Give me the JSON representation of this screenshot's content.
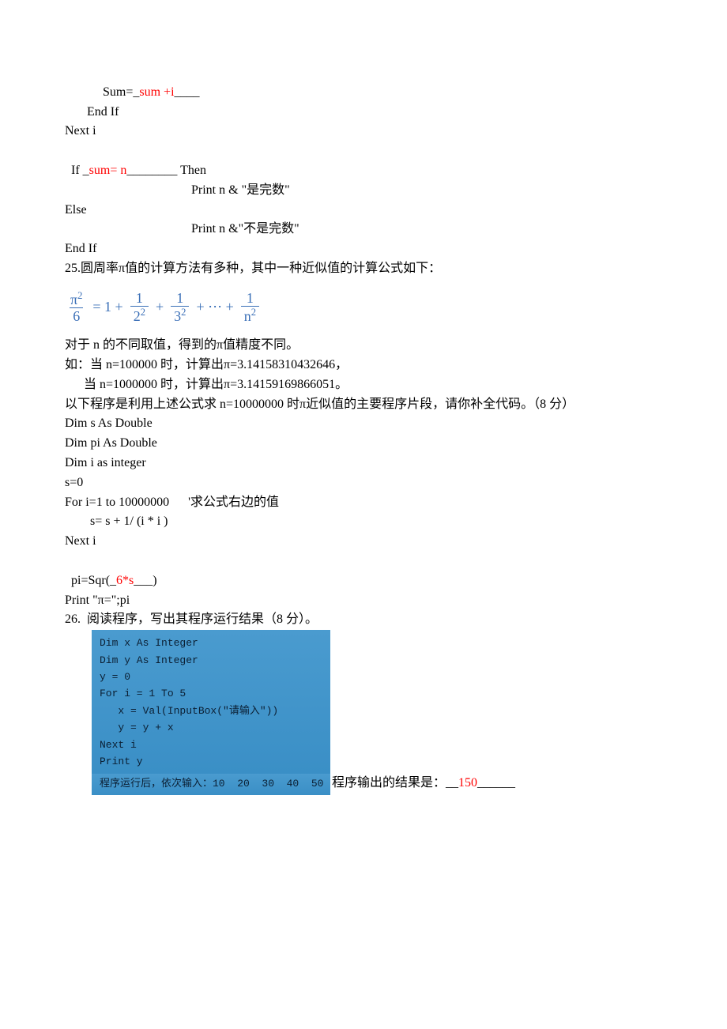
{
  "block24": {
    "l1a": "          Sum=_",
    "l1_ans": "sum +i",
    "l1b": "____",
    "l2": "       End If",
    "l3": "Next i",
    "l4a": "If _",
    "l4_ans": "sum= n",
    "l4b": "________ Then",
    "l5": "Print n & \"是完数\"",
    "l6": "Else",
    "l7": "Print n &\"不是完数\"",
    "l8": "End If"
  },
  "q25": {
    "intro": "25.圆周率π值的计算方法有多种，其中一种近似值的计算公式如下：",
    "formula": {
      "lhs_num": "π",
      "lhs_num_sup": "2",
      "lhs_den": "6",
      "eq": "= 1 +",
      "t2_num": "1",
      "t2_den": "2",
      "t2_den_sup": "2",
      "plus1": "+",
      "t3_num": "1",
      "t3_den": "3",
      "t3_den_sup": "2",
      "dots": "+ ⋯ +",
      "tn_num": "1",
      "tn_den": "n",
      "tn_den_sup": "2"
    },
    "p1": "对于 n 的不同取值，得到的π值精度不同。",
    "p2": "如：当 n=100000 时，计算出π=3.14158310432646，",
    "p3": "      当 n=1000000 时，计算出π=3.14159169866051。",
    "p4": "以下程序是利用上述公式求 n=10000000 时π近似值的主要程序片段，请你补全代码。（8 分）",
    "c1": "Dim s As Double",
    "c2": "Dim pi As Double",
    "c3": "Dim i as integer",
    "c4": "s=0",
    "c5": "For i=1 to 10000000      '求公式右边的值",
    "c6": "s= s + 1/ (i * i )",
    "c7": "Next i",
    "c8a": "pi=Sqr(_",
    "c8_ans": "6*s",
    "c8b": "___)",
    "c9": "Print \"π=\";pi"
  },
  "q26": {
    "title": "26.  阅读程序，写出其程序运行结果（8 分）。",
    "code": {
      "l1": "Dim x As Integer",
      "l2": "Dim y As Integer",
      "l3": "y = 0",
      "l4": "For i = 1 To 5",
      "l5": "   x = Val(InputBox(\"请输入\"))",
      "l6": "   y = y + x",
      "l7": "Next i",
      "l8": "Print y",
      "run": "程序运行后，依次输入：10  20  30  40  50"
    },
    "after_a": "程序输出的结果是：__",
    "after_ans": "150",
    "after_b": "______"
  }
}
